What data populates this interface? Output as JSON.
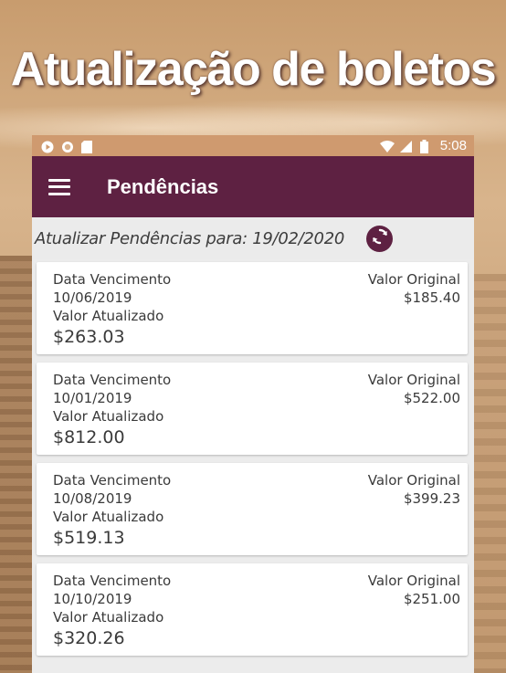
{
  "promo": {
    "title": "Atualização de boletos"
  },
  "status_bar": {
    "time": "5:08",
    "icons_left": [
      "play-icon",
      "circle-icon",
      "sd-card-icon"
    ],
    "icons_right": [
      "wifi-icon",
      "signal-icon",
      "battery-icon"
    ]
  },
  "app_bar": {
    "title": "Pendências",
    "menu_icon": "menu-icon"
  },
  "update": {
    "label": "Atualizar Pendências para: 19/02/2020",
    "refresh_icon": "refresh-icon"
  },
  "labels": {
    "due_date": "Data Vencimento",
    "original_value": "Valor Original",
    "updated_value": "Valor Atualizado"
  },
  "items": [
    {
      "due_date": "10/06/2019",
      "original_value": "$185.40",
      "updated_value": "$263.03"
    },
    {
      "due_date": "10/01/2019",
      "original_value": "$522.00",
      "updated_value": "$812.00"
    },
    {
      "due_date": "10/08/2019",
      "original_value": "$399.23",
      "updated_value": "$519.13"
    },
    {
      "due_date": "10/10/2019",
      "original_value": "$251.00",
      "updated_value": "$320.26"
    }
  ],
  "colors": {
    "app_bar": "#5e2142",
    "status_bar": "#cf9a6f",
    "background": "#ececec",
    "card": "#ffffff",
    "text": "#3a3a3a"
  }
}
